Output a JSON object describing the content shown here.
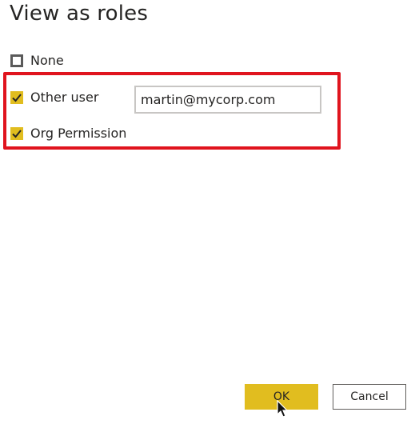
{
  "dialog": {
    "title": "View as roles"
  },
  "options": {
    "none": {
      "label": "None",
      "checked": false
    },
    "other_user": {
      "label": "Other user",
      "checked": true
    },
    "org_permission": {
      "label": "Org Permission",
      "checked": true
    }
  },
  "other_user_input": {
    "value": "martin@mycorp.com"
  },
  "buttons": {
    "ok_label": "OK",
    "cancel_label": "Cancel"
  },
  "colors": {
    "accent": "#e1bd1f",
    "highlight": "#e0141e"
  },
  "icons": {
    "check": "checkmark-icon",
    "cursor": "mouse-pointer-icon"
  }
}
